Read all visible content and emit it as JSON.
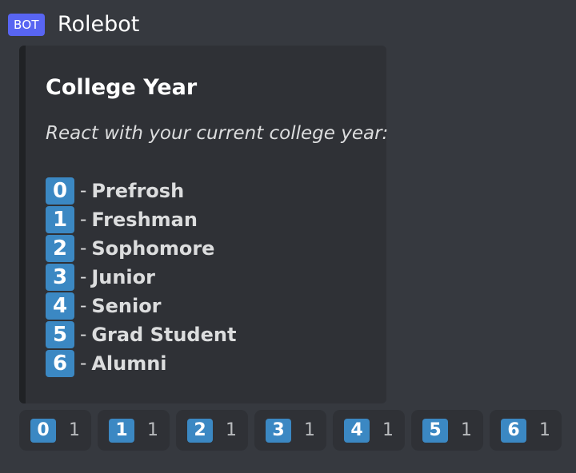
{
  "message": {
    "badge": "BOT",
    "username": "Rolebot"
  },
  "embed": {
    "title": "College Year",
    "description": "React with your current college year:",
    "separator": "-",
    "roles": [
      {
        "key": "0",
        "name": "Prefrosh"
      },
      {
        "key": "1",
        "name": "Freshman"
      },
      {
        "key": "2",
        "name": "Sophomore"
      },
      {
        "key": "3",
        "name": "Junior"
      },
      {
        "key": "4",
        "name": "Senior"
      },
      {
        "key": "5",
        "name": "Grad Student"
      },
      {
        "key": "6",
        "name": "Alumni"
      }
    ]
  },
  "reactions": [
    {
      "emoji": "0",
      "count": "1"
    },
    {
      "emoji": "1",
      "count": "1"
    },
    {
      "emoji": "2",
      "count": "1"
    },
    {
      "emoji": "3",
      "count": "1"
    },
    {
      "emoji": "4",
      "count": "1"
    },
    {
      "emoji": "5",
      "count": "1"
    },
    {
      "emoji": "6",
      "count": "1"
    }
  ],
  "colors": {
    "background": "#36393f",
    "embed_background": "#2f3136",
    "embed_border": "#202225",
    "bot_badge": "#5865f2",
    "keycap": "#3b88c3"
  }
}
